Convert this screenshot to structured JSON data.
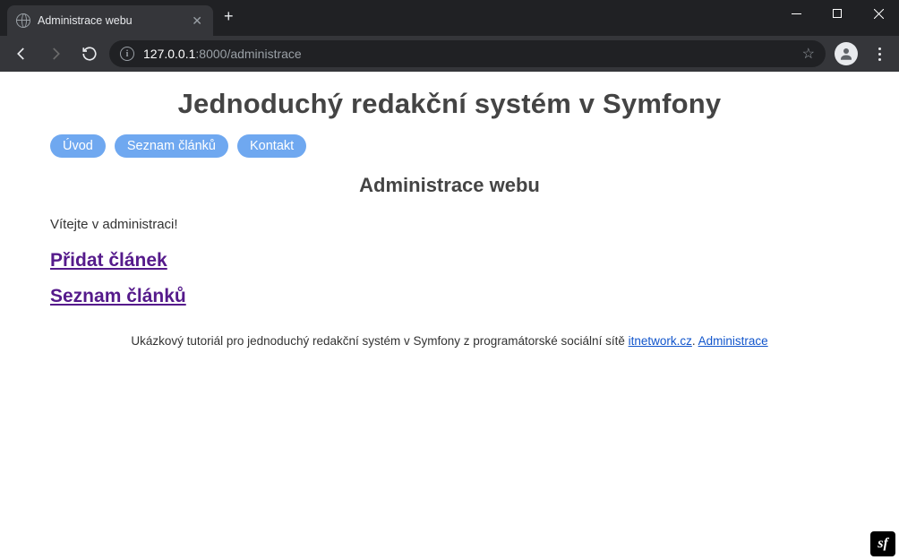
{
  "browser": {
    "tab_title": "Administrace webu",
    "url_host": "127.0.0.1",
    "url_port": ":8000",
    "url_path": "/administrace"
  },
  "page": {
    "main_title": "Jednoduchý redakční systém v Symfony",
    "nav": {
      "home": "Úvod",
      "list": "Seznam článků",
      "contact": "Kontakt"
    },
    "subtitle": "Administrace webu",
    "welcome": "Vítejte v administraci!",
    "actions": {
      "add_article": "Přidat článek",
      "list_articles": "Seznam článků"
    },
    "footer": {
      "text_before": "Ukázkový tutoriál pro jednoduchý redakční systém v Symfony z programátorské sociální sítě ",
      "link1": "itnetwork.cz",
      "sep": ". ",
      "link2": "Administrace"
    }
  },
  "badge": {
    "label": "sf"
  }
}
